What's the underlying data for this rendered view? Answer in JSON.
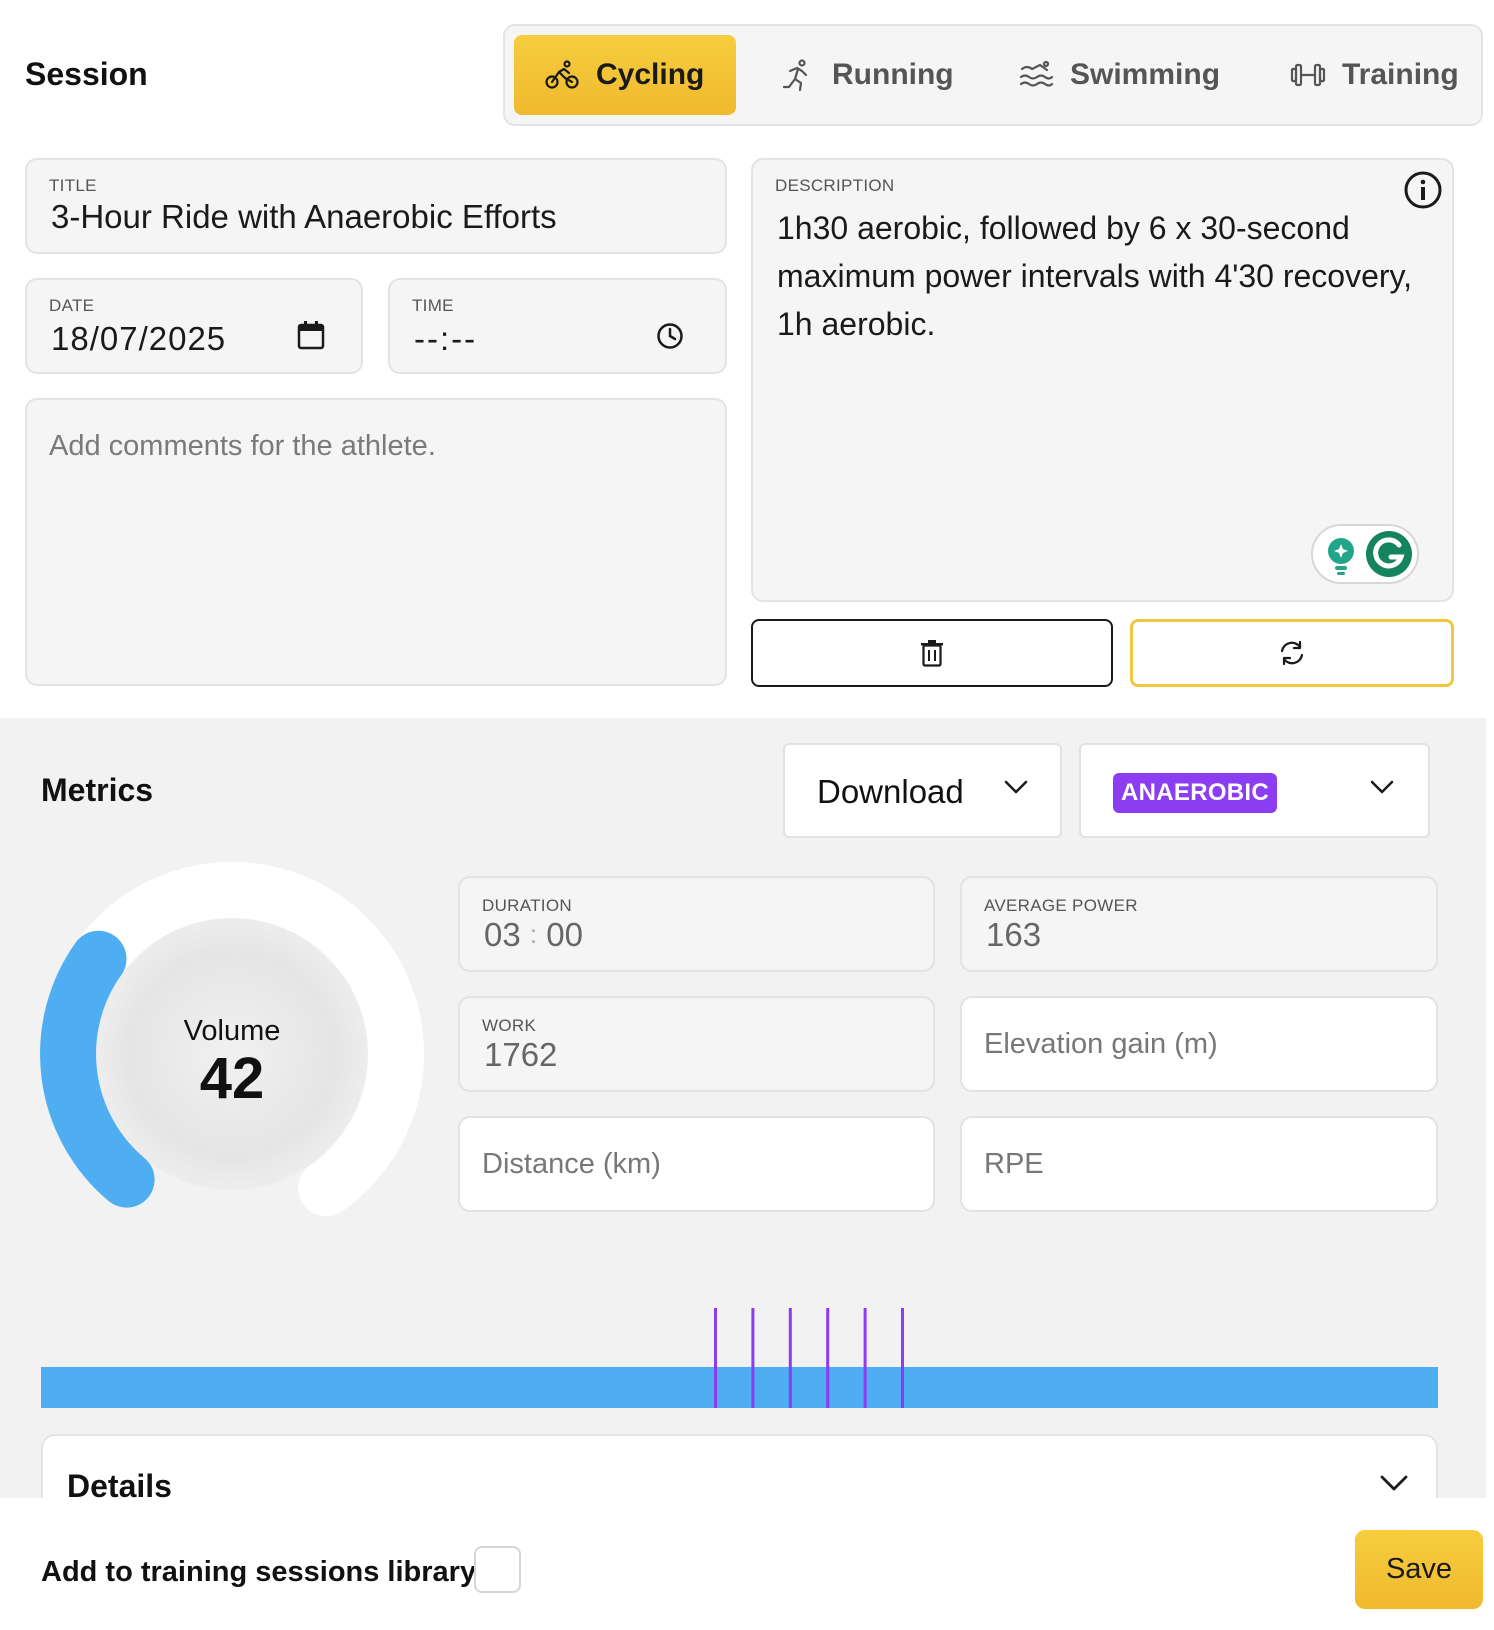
{
  "header": {
    "title": "Session",
    "tabs": [
      {
        "label": "Cycling",
        "icon": "bike-icon",
        "active": true
      },
      {
        "label": "Running",
        "icon": "runner-icon",
        "active": false
      },
      {
        "label": "Swimming",
        "icon": "swimmer-icon",
        "active": false
      },
      {
        "label": "Training",
        "icon": "dumbbell-icon",
        "active": false
      }
    ]
  },
  "form": {
    "title": {
      "label": "TITLE",
      "value": "3-Hour Ride with Anaerobic Efforts"
    },
    "date": {
      "label": "DATE",
      "value": "18/07/2025"
    },
    "time": {
      "label": "TIME",
      "value": "--:--"
    },
    "comments": {
      "placeholder": "Add comments for the athlete."
    },
    "description": {
      "label": "DESCRIPTION",
      "value": "1h30 aerobic, followed by 6 x 30-second maximum power intervals with 4'30 recovery, 1h aerobic."
    }
  },
  "metrics": {
    "title": "Metrics",
    "download_label": "Download",
    "intensity_badge": "ANAEROBIC",
    "volume": {
      "label": "Volume",
      "value": "42",
      "fill_fraction": 0.3
    },
    "fields": {
      "duration": {
        "label": "DURATION",
        "hours": "03",
        "separator": ":",
        "minutes": "00"
      },
      "average_power": {
        "label": "AVERAGE POWER",
        "value": "163"
      },
      "work": {
        "label": "WORK",
        "value": "1762"
      },
      "elevation": {
        "placeholder": "Elevation gain (m)"
      },
      "distance": {
        "placeholder": "Distance (km)"
      },
      "rpe": {
        "placeholder": "RPE"
      }
    },
    "interval_count": 6
  },
  "details": {
    "label": "Details"
  },
  "footer": {
    "library_label": "Add to training sessions library",
    "library_checked": false,
    "save_label": "Save"
  },
  "colors": {
    "accent": "#f2c63e",
    "volume_blue": "#4fadf1",
    "interval_purple": "#8b3df1",
    "badge_purple": "#8b3df1"
  }
}
